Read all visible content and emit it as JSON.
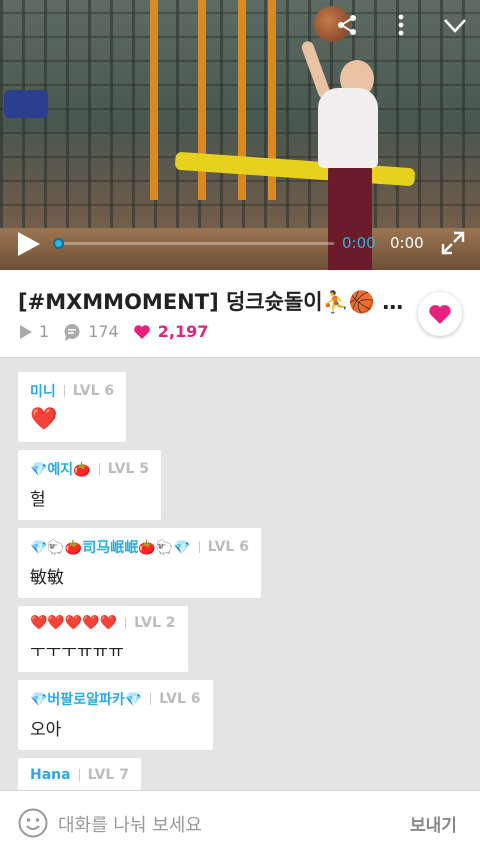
{
  "video": {
    "current_time": "0:00",
    "duration": "0:00",
    "progress": 0
  },
  "post": {
    "title": "[#MXMMOMENT] 덩크슛돌이⛹️🏀 영…",
    "plays": "1",
    "comments": "174",
    "likes": "2,197"
  },
  "messages": [
    {
      "name": "미니",
      "level": "LVL 6",
      "text": "❤️",
      "emoji_text": true
    },
    {
      "name": "💎예지🍅",
      "level": "LVL 5",
      "text": "헐",
      "emoji_text": false
    },
    {
      "name": "💎🐑🍅司马岷岷🍅🐑💎",
      "level": "LVL 6",
      "text": "敏敏",
      "emoji_text": false
    },
    {
      "name": "❤️❤️❤️❤️❤️",
      "level": "LVL 2",
      "text": "ㅜㅜㅜㅠㅠㅠ",
      "emoji_text": false
    },
    {
      "name": "💎버팔로알파카💎",
      "level": "LVL 6",
      "text": "오아",
      "emoji_text": false
    },
    {
      "name": "Hana",
      "level": "LVL 7",
      "text": "",
      "emoji_text": false
    }
  ],
  "composer": {
    "placeholder": "대화를 나눠 보세요",
    "send_label": "보내기"
  },
  "icons": {
    "share": "share-icon",
    "more": "more-vertical-icon",
    "collapse": "chevron-down-icon",
    "play": "play-icon",
    "fullscreen": "fullscreen-icon",
    "views": "play-count-icon",
    "comments": "comment-icon",
    "likes": "heart-icon",
    "like_button": "heart-icon",
    "emoji": "smiley-icon",
    "sticker": "heart-eyes-emoji"
  },
  "colors": {
    "accent": "#29abe2",
    "like": "#e6217e",
    "level": "#bcbcbc"
  }
}
